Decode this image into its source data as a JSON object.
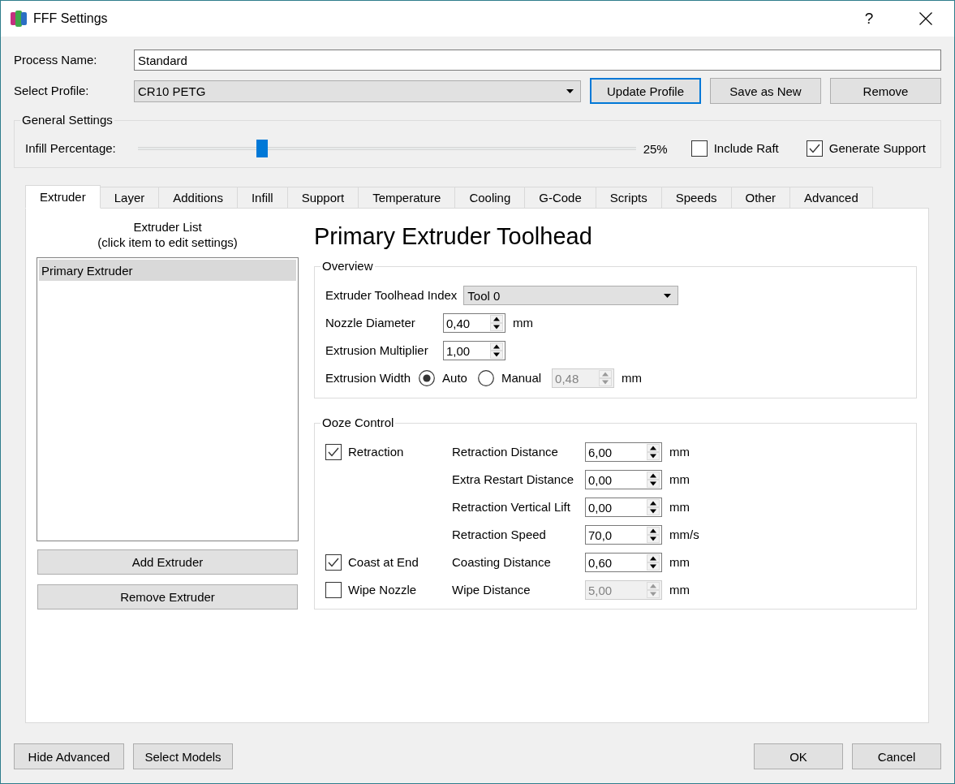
{
  "window": {
    "title": "FFF Settings",
    "help": "?"
  },
  "process_name": {
    "label": "Process Name:",
    "value": "Standard"
  },
  "profile": {
    "label": "Select Profile:",
    "value": "CR10 PETG",
    "buttons": [
      {
        "label": "Update Profile",
        "focused": true
      },
      {
        "label": "Save as New",
        "focused": false
      },
      {
        "label": "Remove",
        "focused": false
      }
    ]
  },
  "general_settings": {
    "title": "General Settings",
    "infill": {
      "label": "Infill Percentage:",
      "level": 0.25,
      "reading": "25%"
    },
    "options": [
      {
        "label": "Include Raft",
        "checked": false
      },
      {
        "label": "Generate Support",
        "checked": true
      }
    ]
  },
  "tabs": [
    {
      "label": "Extruder",
      "selected": true
    },
    {
      "label": "Layer",
      "selected": false
    },
    {
      "label": "Additions",
      "selected": false
    },
    {
      "label": "Infill",
      "selected": false
    },
    {
      "label": "Support",
      "selected": false
    },
    {
      "label": "Temperature",
      "selected": false
    },
    {
      "label": "Cooling",
      "selected": false
    },
    {
      "label": "G-Code",
      "selected": false
    },
    {
      "label": "Scripts",
      "selected": false
    },
    {
      "label": "Speeds",
      "selected": false
    },
    {
      "label": "Other",
      "selected": false
    },
    {
      "label": "Advanced",
      "selected": false
    }
  ],
  "extruder_list": {
    "title": "Extruder List",
    "hint": "(click item to edit settings)",
    "items": [
      {
        "label": "Primary Extruder",
        "selected": true
      }
    ],
    "buttons": [
      "Add Extruder",
      "Remove Extruder"
    ]
  },
  "toolhead": {
    "heading": "Primary Extruder Toolhead",
    "overview": {
      "title": "Overview",
      "rows": [
        {
          "kind": "dropdown",
          "label": "Extruder Toolhead Index",
          "value": "Tool 0",
          "disabled": false
        },
        {
          "kind": "spin",
          "label": "Nozzle Diameter",
          "value": "0,40",
          "unit": "mm",
          "disabled": false
        },
        {
          "kind": "spin",
          "label": "Extrusion Multiplier",
          "value": "1,00",
          "disabled": false
        },
        {
          "kind": "radio",
          "label": "Extrusion Width",
          "options": [
            {
              "label": "Auto",
              "selected": true
            },
            {
              "label": "Manual",
              "selected": false
            }
          ],
          "value": "0,48",
          "unit": "mm",
          "disabled": true
        }
      ]
    },
    "ooze_control": {
      "title": "Ooze Control",
      "rows": [
        {
          "toggle": {
            "label": "Retraction",
            "checked": true
          },
          "label": "Retraction Distance",
          "value": "6,00",
          "unit": "mm",
          "disabled": false
        },
        {
          "label": "Extra Restart Distance",
          "value": "0,00",
          "unit": "mm",
          "disabled": false
        },
        {
          "label": "Retraction Vertical Lift",
          "value": "0,00",
          "unit": "mm",
          "disabled": false
        },
        {
          "label": "Retraction Speed",
          "value": "70,0",
          "unit": "mm/s",
          "disabled": false
        },
        {
          "toggle": {
            "label": "Coast at End",
            "checked": true
          },
          "label": "Coasting Distance",
          "value": "0,60",
          "unit": "mm",
          "disabled": false
        },
        {
          "toggle": {
            "label": "Wipe Nozzle",
            "checked": false
          },
          "label": "Wipe Distance",
          "value": "5,00",
          "unit": "mm",
          "disabled": true
        }
      ]
    }
  },
  "footer": {
    "left_buttons": [
      "Hide Advanced",
      "Select Models"
    ],
    "right_buttons": [
      "OK",
      "Cancel"
    ]
  }
}
